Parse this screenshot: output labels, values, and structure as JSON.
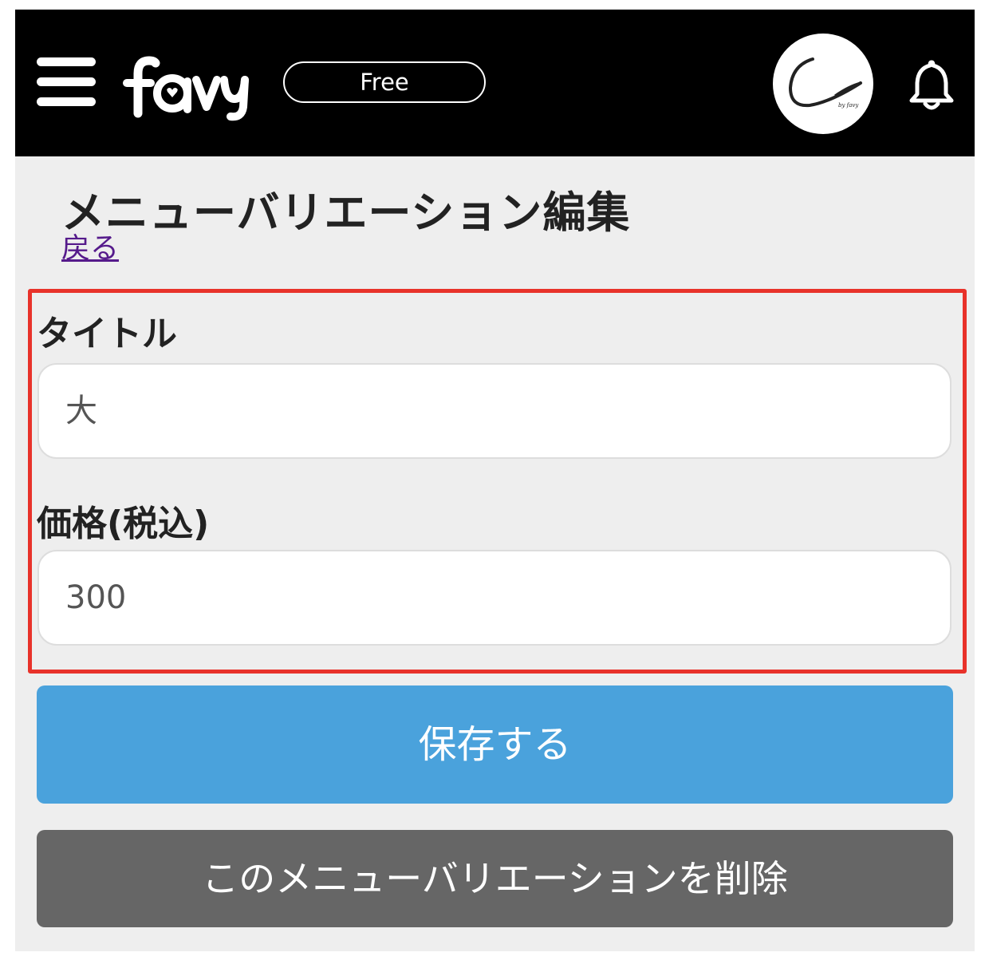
{
  "header": {
    "logo_text": "favy",
    "plan_badge": "Free",
    "avatar_text": "by favy"
  },
  "page": {
    "title": "メニューバリエーション編集",
    "back_link": "戻る"
  },
  "form": {
    "title_label": "タイトル",
    "title_value": "大",
    "price_label": "価格(税込)",
    "price_value": "300"
  },
  "actions": {
    "save_label": "保存する",
    "delete_label": "このメニューバリエーションを削除"
  },
  "colors": {
    "header_bg": "#000000",
    "save_button": "#4aa2dc",
    "delete_button": "#666666",
    "highlight_border": "#e8322a",
    "link": "#551a8b"
  }
}
